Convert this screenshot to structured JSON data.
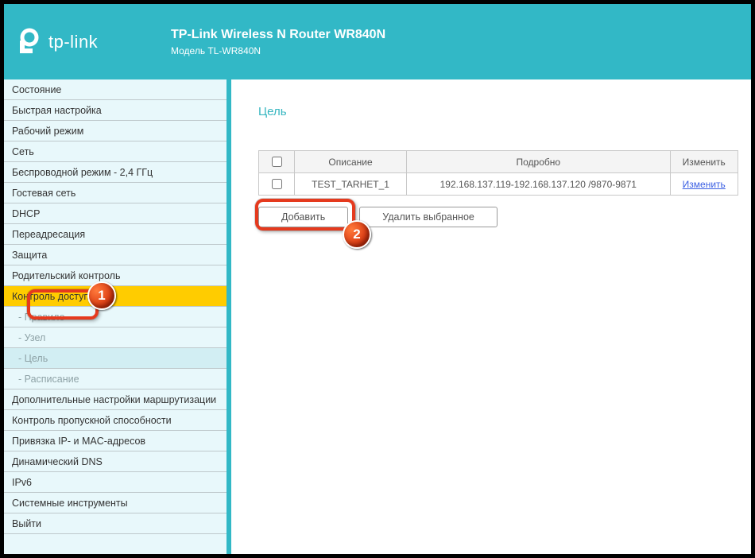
{
  "header": {
    "brand": "tp-link",
    "title": "TP-Link Wireless N Router WR840N",
    "model": "Модель TL-WR840N"
  },
  "nav": {
    "items": [
      "Состояние",
      "Быстрая настройка",
      "Рабочий режим",
      "Сеть",
      "Беспроводной режим - 2,4 ГГц",
      "Гостевая сеть",
      "DHCP",
      "Переадресация",
      "Защита",
      "Родительский контроль"
    ],
    "active": "Контроль доступа",
    "subs": [
      "Правило",
      "Узел",
      "Цель",
      "Расписание"
    ],
    "sub_current_index": 2,
    "items2": [
      "Дополнительные настройки маршрутизации",
      "Контроль пропускной способности",
      "Привязка IP- и MAC-адресов",
      "Динамический DNS",
      "IPv6",
      "Системные инструменты",
      "Выйти"
    ]
  },
  "page": {
    "title": "Цель",
    "table": {
      "head": {
        "desc": "Описание",
        "detail": "Подробно",
        "edit": "Изменить"
      },
      "rows": [
        {
          "desc": "TEST_TARHET_1",
          "detail": "192.168.137.119-192.168.137.120 /9870-9871",
          "edit": "Изменить"
        }
      ]
    },
    "buttons": {
      "add": "Добавить",
      "del": "Удалить выбранное"
    }
  },
  "markers": {
    "m1": "1",
    "m2": "2"
  }
}
